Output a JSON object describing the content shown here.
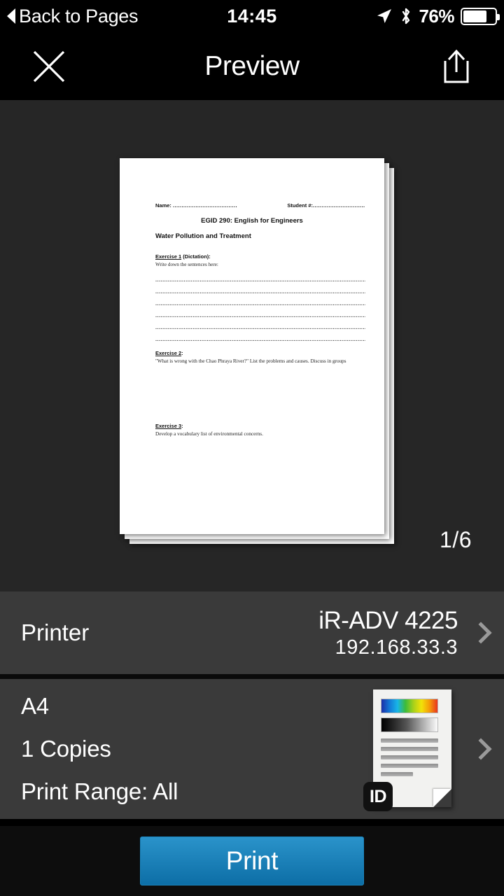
{
  "status_bar": {
    "back_label": "Back to Pages",
    "time": "14:45",
    "battery_percent": "76%",
    "battery_level": 76,
    "location_icon": "location-arrow-icon",
    "bluetooth_icon": "bluetooth-icon"
  },
  "nav": {
    "title": "Preview",
    "close_icon": "close-x-icon",
    "share_icon": "share-upload-icon"
  },
  "preview": {
    "page_counter": "1/6",
    "background_color": "#262626",
    "document": {
      "name_label": "Name:",
      "name_dots": "........................................",
      "student_label": "Student #:",
      "student_dots": "...................................",
      "course_title": "EGID 290: English for Engineers",
      "topic_title": "Water Pollution and Treatment",
      "exercise1_head": "Exercise 1",
      "exercise1_head_rest": " (Dictation):",
      "exercise1_sub": "Write down the sentences here:",
      "dotted_line": "........................................................................................................................................................................................................................",
      "dotted_line_count": 6,
      "exercise2_head": "Exercise 2",
      "exercise2_head_rest": ":",
      "exercise2_body": "\"What is wrong with the Chao Phraya River?\"    List the problems and causes. Discuss in groups",
      "exercise3_head": "Exercise 3",
      "exercise3_head_rest": ":",
      "exercise3_body": "Develop a vocabulary list of environmental concerns."
    }
  },
  "printer_row": {
    "label": "Printer",
    "printer_name": "iR-ADV 4225",
    "printer_ip": "192.168.33.3",
    "chevron_icon": "chevron-right-icon"
  },
  "options_row": {
    "paper_size": "A4",
    "copies": "1 Copies",
    "print_range": "Print Range: All",
    "chevron_icon": "chevron-right-icon",
    "thumbnail": {
      "badge_label": "ID",
      "icon": "document-thumbnail-icon",
      "text_line_count": 5
    }
  },
  "print_bar": {
    "print_label": "Print",
    "accent_color": "#1a84bd"
  }
}
